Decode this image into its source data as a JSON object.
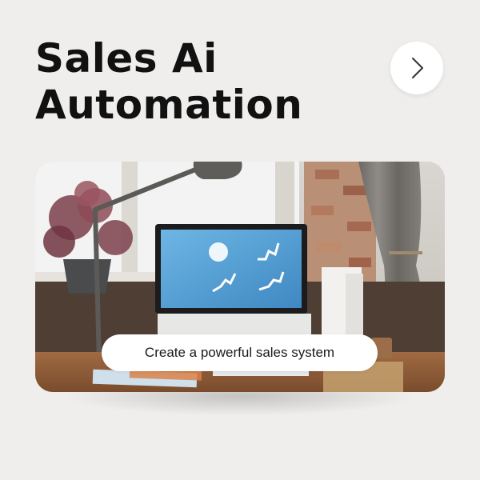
{
  "header": {
    "title_line1": "Sales Ai",
    "title_line2": "Automation"
  },
  "nav": {
    "next_icon": "chevron-right-icon"
  },
  "card": {
    "caption": "Create a powerful sales system"
  },
  "colors": {
    "background": "#efeeec",
    "title": "#111111",
    "pill": "#ffffff",
    "screen": "#5aa7d8"
  }
}
